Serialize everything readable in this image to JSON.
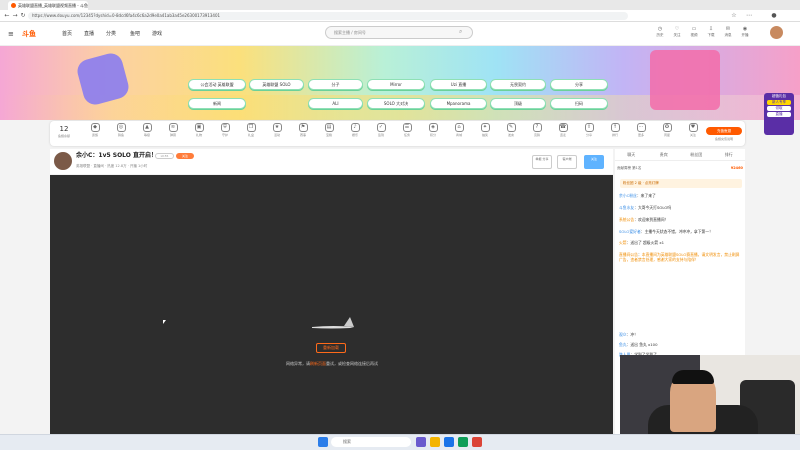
{
  "browser": {
    "tab_title": "英雄联盟直播_英雄联盟视频直播 - 斗鱼",
    "url": "https://www.douyu.com/12345?dyshid=0-8dcd6fa4c6c6a2d9e0a41ab3a45e26300173913401",
    "back_icon": "arrow-left",
    "forward_icon": "arrow-right",
    "reload_icon": "reload"
  },
  "header": {
    "logo": "斗鱼",
    "menu": [
      "首页",
      "直播",
      "分类",
      "鱼吧",
      "游戏"
    ],
    "search_placeholder": "搜索主播 / 房间号",
    "icons": [
      {
        "icon": "history-icon",
        "label": "历史"
      },
      {
        "icon": "follow-icon",
        "label": "关注"
      },
      {
        "icon": "video-icon",
        "label": "视频"
      },
      {
        "icon": "download-icon",
        "label": "下载"
      },
      {
        "icon": "message-icon",
        "label": "消息"
      },
      {
        "icon": "broadcast-icon",
        "label": "开播"
      }
    ]
  },
  "banner": {
    "buttons_row1": [
      "公会活动 英雄联盟",
      "英雄联盟 SOLO",
      "分子",
      "Mirror",
      "Uzi 直播",
      "无畏契约",
      "分享"
    ],
    "buttons_row2": [
      "新闻",
      "ALI",
      "SOLO 大对决",
      "Mpanorama",
      "顶级",
      "扫码"
    ],
    "side_promo": {
      "line1": "超值礼包",
      "line2": "新人专享",
      "line3": "领取",
      "line4": "直播"
    }
  },
  "gift_bar": {
    "count": "12",
    "count_label": "鱼翅余额",
    "items": [
      "贵族",
      "猜鱼",
      "等级",
      "弹幕",
      "礼物",
      "守护",
      "礼盒",
      "活动",
      "赛事",
      "宝箱",
      "娱乐",
      "签到",
      "任务",
      "积分",
      "商城",
      "抽奖",
      "发言",
      "竞猜",
      "连麦",
      "分享",
      "排行",
      "更多",
      "周星",
      "关注"
    ],
    "pay_label": "充值鱼翅",
    "pay_sub": "鱼翅充值说明"
  },
  "room": {
    "title": "余小C：1v5 SOLO 直开启！",
    "level": "LV.55",
    "follow": "关注",
    "meta": "英雄联盟 · 直播间 · 热度 12.8万 · 开播 1小时",
    "btn1": "举报\n分享",
    "btn2": "客户端",
    "btn3": "关注"
  },
  "player": {
    "reload_label": "重新加载",
    "msg_prefix": "网络异常，请",
    "msg_link": "刷新页面",
    "msg_suffix": "重试，或检查网络连接后再试"
  },
  "chat": {
    "tabs": [
      "聊天",
      "贵宾",
      "粉丝团",
      "排行"
    ],
    "rank_label": "贡献周榜 第1名",
    "rank_value": "¥2460",
    "fan_label": "粉丝团 2 级 · 点亮灯牌",
    "messages": [
      {
        "user": "余小C粉丝",
        "text": "来了来了"
      },
      {
        "user": "斗鱼水友",
        "text": "大哥今天打SOLO吗"
      },
      {
        "user": "系统公告",
        "text": "欢迎来到直播间！"
      },
      {
        "user": "SOLO爱好者",
        "text": "主播今天状态不错，冲冲冲，拿下第一！"
      },
      {
        "user": "火箭",
        "text": "送出了 超级火箭 x1"
      },
      {
        "user": "直播间公告",
        "text": "本直播间为英雄联盟SOLO赛直播，请文明发言，禁止刷屏广告，违者禁言处理，感谢大家的支持与陪伴！"
      },
      {
        "user": "观众",
        "text": "冲！"
      },
      {
        "user": "鱼丸",
        "text": "送出 鱼丸 x100"
      },
      {
        "user": "路人甲",
        "text": "学到了学到了"
      }
    ]
  },
  "taskbar": {
    "search": "搜索"
  },
  "colors": {
    "brand": "#ff5a00",
    "accent": "#ff7c3a",
    "video_bg": "#2d2d2d"
  }
}
